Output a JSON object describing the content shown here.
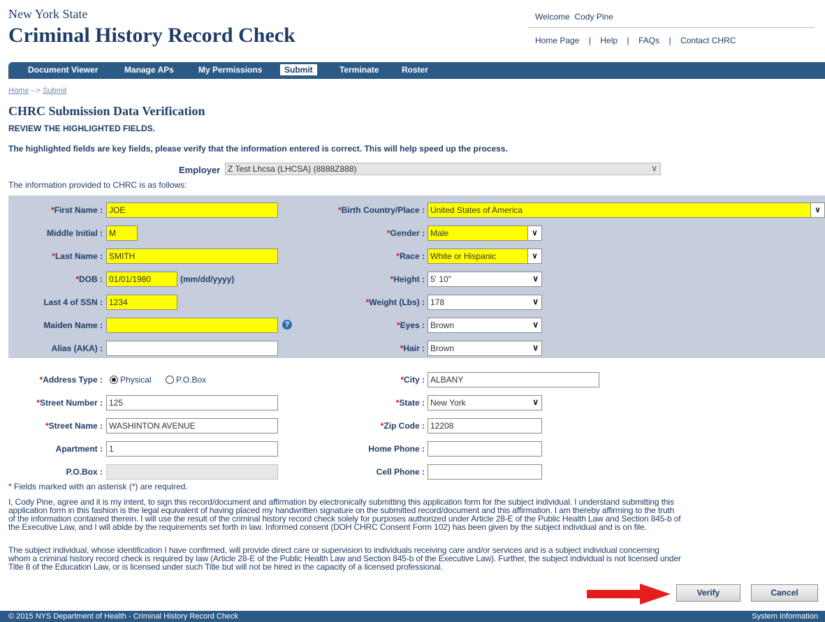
{
  "header": {
    "state": "New York State",
    "title": "Criminal History Record Check",
    "welcome": "Welcome  Cody Pine",
    "links": [
      "Home Page",
      "Help",
      "FAQs",
      "Contact CHRC"
    ],
    "separator": "|"
  },
  "nav": {
    "items": [
      "Document Viewer",
      "Manage APs",
      "My Permissions",
      "Submit",
      "Terminate",
      "Roster"
    ],
    "active": "Submit"
  },
  "breadcrumb": {
    "home": "Home",
    "arrow": "-->",
    "current": "Submit"
  },
  "page": {
    "heading": "CHRC Submission Data Verification",
    "review": "REVIEW THE HIGHLIGHTED FIELDS.",
    "key_fields_note": "The highlighted fields are key fields, please verify that the information entered is correct. This will help speed up the process.",
    "employer_label": "Employer",
    "employer_value": "Z Test Lhcsa (LHCSA) (8888Z888)",
    "info_intro": "The information provided to CHRC is as follows:"
  },
  "labels": {
    "first_name": "First Name :",
    "middle_initial": "Middle Initial :",
    "last_name": "Last Name :",
    "dob": "DOB :",
    "dob_hint": "(mm/dd/yyyy)",
    "ssn": "Last 4 of SSN :",
    "maiden": "Maiden Name :",
    "alias": "Alias (AKA) :",
    "birth_country": "Birth Country/Place :",
    "gender": "Gender :",
    "race": "Race :",
    "height": "Height :",
    "weight": "Weight (Lbs) :",
    "eyes": "Eyes :",
    "hair": "Hair :",
    "address_type": "Address Type :",
    "street_number": "Street Number :",
    "street_name": "Street Name :",
    "apartment": "Apartment :",
    "po_box": "P.O.Box :",
    "city": "City :",
    "state": "State :",
    "zip": "Zip Code :",
    "home_phone": "Home Phone :",
    "cell_phone": "Cell Phone :",
    "star": "*"
  },
  "values": {
    "first_name": "JOE",
    "middle_initial": "M",
    "last_name": "SMITH",
    "dob": "01/01/1980",
    "ssn": "1234",
    "maiden": "",
    "alias": "",
    "birth_country": "United States of America",
    "gender": "Male",
    "race": "White or Hispanic",
    "height": "5' 10\"",
    "weight": "178",
    "eyes": "Brown",
    "hair": "Brown",
    "address_physical": "Physical",
    "address_pobox": "P.O.Box",
    "street_number": "125",
    "street_name": "WASHINTON AVENUE",
    "apartment": "1",
    "po_box": "",
    "city": "ALBANY",
    "state": "New York",
    "zip": "12208",
    "home_phone": "",
    "cell_phone": ""
  },
  "notes": {
    "required_prefix": "* Fields marked with an asterisk (",
    "required_star": "*",
    "required_suffix": ") are required.",
    "affirmation_lines": [
      "I, Cody Pine, agree and it is my intent, to sign this record/document and affirmation by electronically submitting this application form for the subject individual. I understand submitting this",
      "application form in this fashion is the legal equivalent of having placed my handwritten signature on the submitted record/document and this affirmation. I am thereby affirming to the truth",
      "of the information contained therein. I will use the result of the criminal history record check solely for purposes authorized under Article 28-E of the Public Health Law and Section 845-b of",
      "the Executive Law, and I will abide by the requirements set forth in law. Informed consent (DOH CHRC Consent Form 102) has been given by the subject individual and is on file."
    ],
    "subject_lines": [
      "The subject individual, whose identification I have confirmed, will provide direct care or supervision to individuals receiving care and/or services and is a subject individual concerning",
      "whom a criminal history record check is required by law (Article 28-E of the Public Health Law and Section 845-b of the Executive Law). Further, the subject individual is not licensed under",
      "Title 8 of the Education Law, or is licensed under such Title but will not be hired in the capacity of a licensed professional."
    ]
  },
  "buttons": {
    "verify": "Verify",
    "cancel": "Cancel"
  },
  "footer": {
    "left": "© 2015 NYS Department of Health - Criminal History Record Check",
    "right": "System Information"
  },
  "colors": {
    "nav": "#2b5a86",
    "highlight": "#ffff00",
    "panel": "#c6cedd",
    "required": "#d4141a",
    "arrow": "#e41e1e"
  },
  "icons": {
    "help": "question-circle-icon",
    "arrow": "red-arrow-icon",
    "dropdown": "chevron-down-icon"
  }
}
